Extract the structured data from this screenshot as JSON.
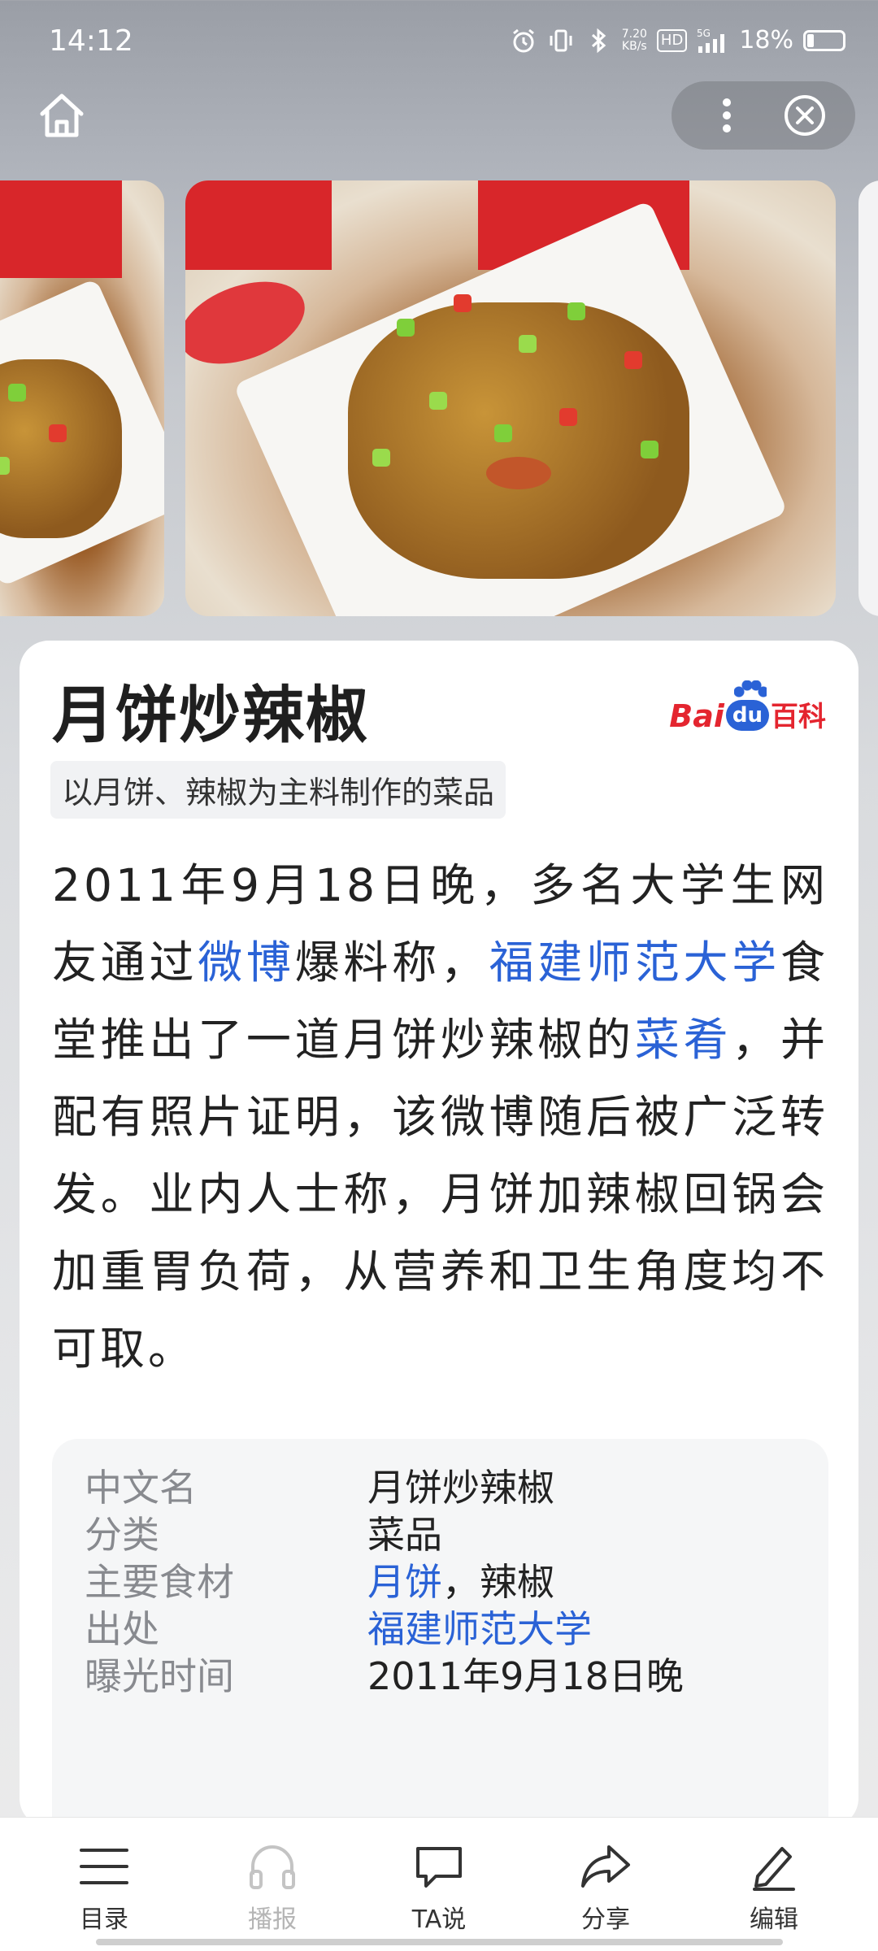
{
  "status_bar": {
    "time": "14:12",
    "net_speed_value": "7.20",
    "net_speed_unit": "KB/s",
    "hd": "HD",
    "network": "5G",
    "battery": "18%",
    "icons": [
      "alarm-icon",
      "vibrate-icon",
      "bluetooth-icon",
      "signal-icon",
      "battery-icon"
    ]
  },
  "nav": {
    "icons": [
      "home-icon",
      "more-icon",
      "close-icon"
    ]
  },
  "article": {
    "title": "月饼炒辣椒",
    "source_logo": {
      "bai": "Bai",
      "du": "du",
      "baike": "百科"
    },
    "subtitle": "以月饼、辣椒为主料制作的菜品",
    "summary": [
      {
        "text": "2011年9月18日晚，多名大学生网友通过",
        "link": false
      },
      {
        "text": "微博",
        "link": true
      },
      {
        "text": "爆料称，",
        "link": false
      },
      {
        "text": "福建师范大学",
        "link": true
      },
      {
        "text": "食堂推出了一道月饼炒辣椒的",
        "link": false
      },
      {
        "text": "菜肴",
        "link": true
      },
      {
        "text": "，并配有照片证明，该微博随后被广泛转发。业内人士称，月饼加辣椒回锅会加重胃负荷，从营养和卫生角度均不可取。",
        "link": false
      }
    ],
    "infobox": [
      {
        "label": "中文名",
        "value": [
          {
            "text": "月饼炒辣椒",
            "link": false
          }
        ]
      },
      {
        "label": "分类",
        "value": [
          {
            "text": "菜品",
            "link": false
          }
        ]
      },
      {
        "label": "主要食材",
        "value": [
          {
            "text": "月饼",
            "link": true
          },
          {
            "text": "，辣椒",
            "link": false
          }
        ]
      },
      {
        "label": "出处",
        "value": [
          {
            "text": "福建师范大学",
            "link": true
          }
        ]
      },
      {
        "label": "曝光时间",
        "value": [
          {
            "text": "2011年9月18日晚",
            "link": false
          }
        ]
      }
    ]
  },
  "toolbar": {
    "items": [
      {
        "label": "目录",
        "icon": "menu-icon",
        "enabled": true
      },
      {
        "label": "播报",
        "icon": "headphones-icon",
        "enabled": false
      },
      {
        "label": "TA说",
        "icon": "comment-icon",
        "enabled": true
      },
      {
        "label": "分享",
        "icon": "share-icon",
        "enabled": true
      },
      {
        "label": "编辑",
        "icon": "edit-icon",
        "enabled": true
      }
    ]
  },
  "colors": {
    "link": "#2a62d6",
    "logo_red": "#e4252f",
    "logo_blue": "#2a62d6"
  }
}
